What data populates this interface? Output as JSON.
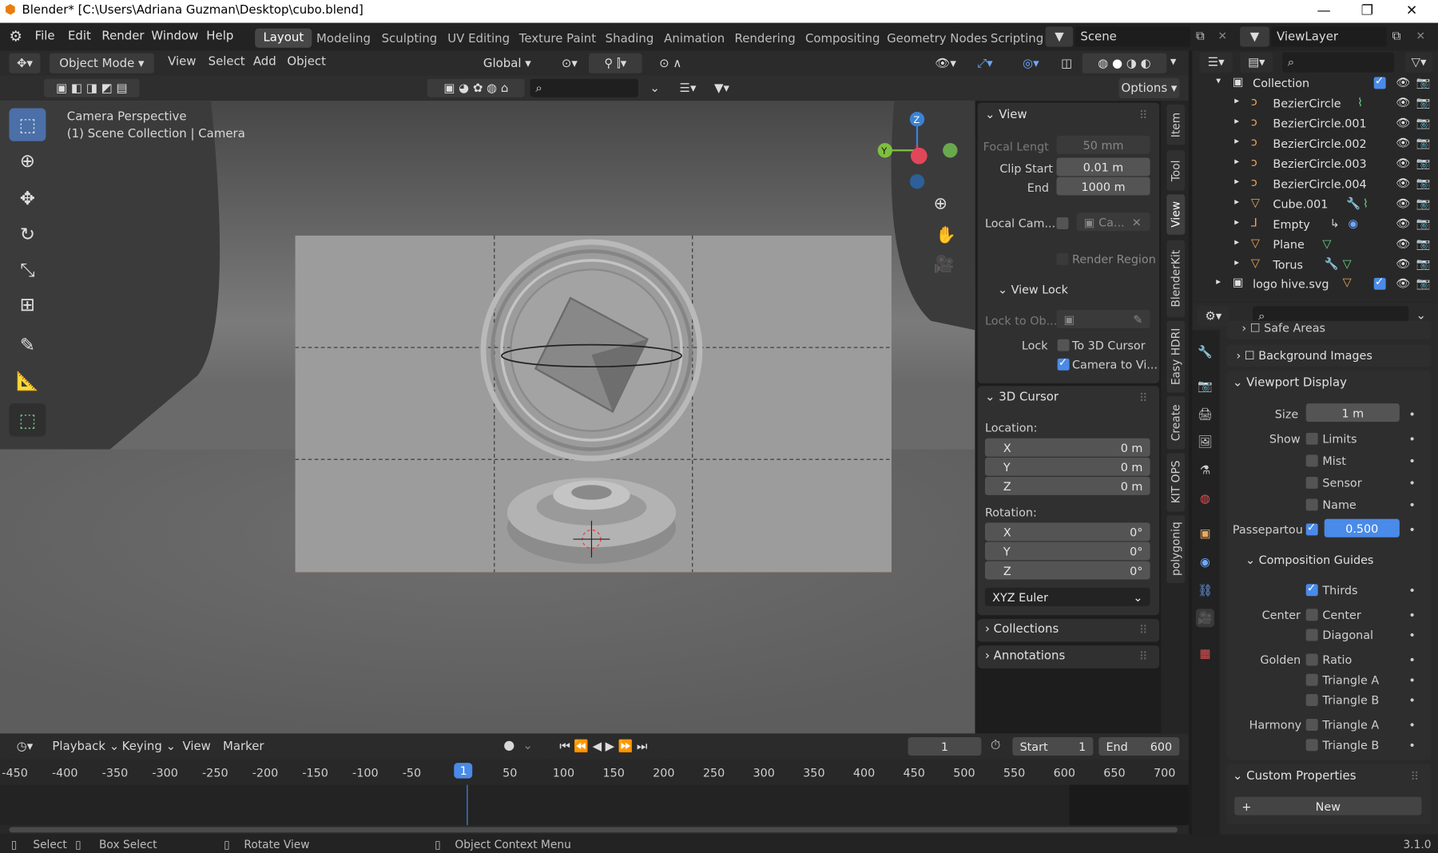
{
  "window": {
    "title": "Blender* [C:\\Users\\Adriana Guzman\\Desktop\\cubo.blend]",
    "version": "3.1.0"
  },
  "menu": [
    "File",
    "Edit",
    "Render",
    "Window",
    "Help"
  ],
  "workspaces": [
    "Layout",
    "Modeling",
    "Sculpting",
    "UV Editing",
    "Texture Paint",
    "Shading",
    "Animation",
    "Rendering",
    "Compositing",
    "Geometry Nodes",
    "Scripting"
  ],
  "scene": "Scene",
  "view_layer": "ViewLayer",
  "header": {
    "mode": "Object Mode",
    "menus": [
      "View",
      "Select",
      "Add",
      "Object"
    ],
    "transform": "Global",
    "options": "Options"
  },
  "viewport": {
    "info1": "Camera Perspective",
    "info2": "(1) Scene Collection | Camera",
    "gizmo_x": "Y",
    "gizmo_z": "Z"
  },
  "npanel": {
    "view_title": "View",
    "focal_label": "Focal Lengt",
    "focal_value": "50 mm",
    "clip_start_label": "Clip Start",
    "clip_start_value": "0.01 m",
    "end_label": "End",
    "end_value": "1000 m",
    "local_cam_label": "Local Cam...",
    "local_cam_value": "Ca...",
    "render_region": "Render Region",
    "view_lock_title": "View Lock",
    "lock_to_ob": "Lock to Ob...",
    "lock_label": "Lock",
    "to_3d_cursor": "To 3D Cursor",
    "camera_to_vi": "Camera to Vi...",
    "cursor_title": "3D Cursor",
    "location_label": "Location:",
    "loc": [
      {
        "axis": "X",
        "value": "0 m"
      },
      {
        "axis": "Y",
        "value": "0 m"
      },
      {
        "axis": "Z",
        "value": "0 m"
      }
    ],
    "rotation_label": "Rotation:",
    "rot": [
      {
        "axis": "X",
        "value": "0°"
      },
      {
        "axis": "Y",
        "value": "0°"
      },
      {
        "axis": "Z",
        "value": "0°"
      }
    ],
    "rot_mode": "XYZ Euler",
    "collections": "Collections",
    "annotations": "Annotations"
  },
  "sidetabs": [
    "Item",
    "Tool",
    "View",
    "BlenderKit",
    "Easy HDRI",
    "Create",
    "KIT OPS",
    "polygoniq"
  ],
  "outliner": [
    {
      "name": "Collection",
      "indent": 0
    },
    {
      "name": "BezierCircle",
      "indent": 1
    },
    {
      "name": "BezierCircle.001",
      "indent": 1
    },
    {
      "name": "BezierCircle.002",
      "indent": 1
    },
    {
      "name": "BezierCircle.003",
      "indent": 1
    },
    {
      "name": "BezierCircle.004",
      "indent": 1
    },
    {
      "name": "Cube.001",
      "indent": 1
    },
    {
      "name": "Empty",
      "indent": 1
    },
    {
      "name": "Plane",
      "indent": 1
    },
    {
      "name": "Torus",
      "indent": 1
    },
    {
      "name": "logo hive.svg",
      "indent": 0
    }
  ],
  "properties": {
    "safe_areas": "Safe Areas",
    "background_images": "Background Images",
    "viewport_display": "Viewport Display",
    "size_label": "Size",
    "size_value": "1 m",
    "show_label": "Show",
    "limits": "Limits",
    "mist": "Mist",
    "sensor": "Sensor",
    "name": "Name",
    "passepartout_label": "Passepartou",
    "passepartout_value": "0.500",
    "composition_guides": "Composition Guides",
    "thirds": "Thirds",
    "center_label": "Center",
    "center": "Center",
    "diagonal": "Diagonal",
    "golden_label": "Golden",
    "ratio": "Ratio",
    "triangle_a": "Triangle A",
    "triangle_b": "Triangle B",
    "harmony_label": "Harmony",
    "h_triangle_a": "Triangle A",
    "h_triangle_b": "Triangle B",
    "custom_properties": "Custom Properties",
    "new": "New"
  },
  "timeline": {
    "menus": [
      "Playback",
      "Keying",
      "View",
      "Marker"
    ],
    "current_frame": "1",
    "start_label": "Start",
    "start": "1",
    "end_label": "End",
    "end": "600",
    "ticks": [
      "-450",
      "-400",
      "-350",
      "-300",
      "-250",
      "-200",
      "-150",
      "-100",
      "-50",
      "1",
      "50",
      "100",
      "150",
      "200",
      "250",
      "300",
      "350",
      "400",
      "450",
      "500",
      "550",
      "600",
      "650",
      "700"
    ]
  },
  "status": {
    "select": "Select",
    "box_select": "Box Select",
    "rotate_view": "Rotate View",
    "context_menu": "Object Context Menu"
  }
}
